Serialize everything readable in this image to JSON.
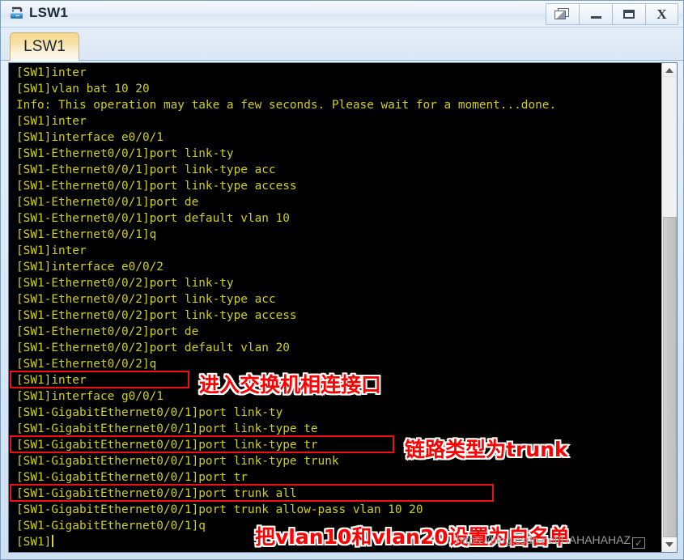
{
  "window": {
    "title": "LSW1",
    "icon": "switch-icon",
    "buttons": {
      "restore": "restore-cascade",
      "minimize": "minimize",
      "maximize": "maximize",
      "close": "X"
    }
  },
  "tabs": [
    {
      "label": "LSW1",
      "active": true
    }
  ],
  "terminal": {
    "foreground_color": "#cfcf1c",
    "background_color": "#000000",
    "lines": [
      "[SW1]inter",
      "[SW1]vlan bat 10 20",
      "Info: This operation may take a few seconds. Please wait for a moment...done.",
      "[SW1]inter",
      "[SW1]interface e0/0/1",
      "[SW1-Ethernet0/0/1]port link-ty",
      "[SW1-Ethernet0/0/1]port link-type acc",
      "[SW1-Ethernet0/0/1]port link-type access",
      "[SW1-Ethernet0/0/1]port de",
      "[SW1-Ethernet0/0/1]port default vlan 10",
      "[SW1-Ethernet0/0/1]q",
      "[SW1]inter",
      "[SW1]interface e0/0/2",
      "[SW1-Ethernet0/0/2]port link-ty",
      "[SW1-Ethernet0/0/2]port link-type acc",
      "[SW1-Ethernet0/0/2]port link-type access",
      "[SW1-Ethernet0/0/2]port de",
      "[SW1-Ethernet0/0/2]port default vlan 20",
      "[SW1-Ethernet0/0/2]q",
      "[SW1]inter",
      "[SW1]interface g0/0/1",
      "[SW1-GigabitEthernet0/0/1]port link-ty",
      "[SW1-GigabitEthernet0/0/1]port link-type te",
      "[SW1-GigabitEthernet0/0/1]port link-type tr",
      "[SW1-GigabitEthernet0/0/1]port link-type trunk",
      "[SW1-GigabitEthernet0/0/1]port tr",
      "[SW1-GigabitEthernet0/0/1]port trunk all",
      "[SW1-GigabitEthernet0/0/1]port trunk allow-pass vlan 10 20",
      "[SW1-GigabitEthernet0/0/1]q",
      "[SW1]"
    ],
    "prompt_cursor": true
  },
  "annotations": [
    {
      "text": "进入交换机相连接口",
      "color": "#ff0000"
    },
    {
      "text": "链路类型为trunk",
      "color": "#ff0000"
    },
    {
      "text": "把vlan10和vlan20设置为白名单",
      "color": "#ff0000"
    }
  ],
  "highlight_boxes": [
    {
      "target_line": "[SW1]interface g0/0/1",
      "color": "#ee1111"
    },
    {
      "target_line": "[SW1-GigabitEthernet0/0/1]port link-type trunk",
      "color": "#ee1111"
    },
    {
      "target_line": "[SW1-GigabitEthernet0/0/1]port trunk allow-pass vlan 10 20",
      "color": "#ee1111"
    }
  ],
  "scrollbar": {
    "up_arrow": "chevron-up-icon",
    "down_arrow": "chevron-down-icon"
  },
  "watermark": {
    "text": "https://blog.csdn.net/HAHAHAHAZ",
    "badge": "✓"
  }
}
